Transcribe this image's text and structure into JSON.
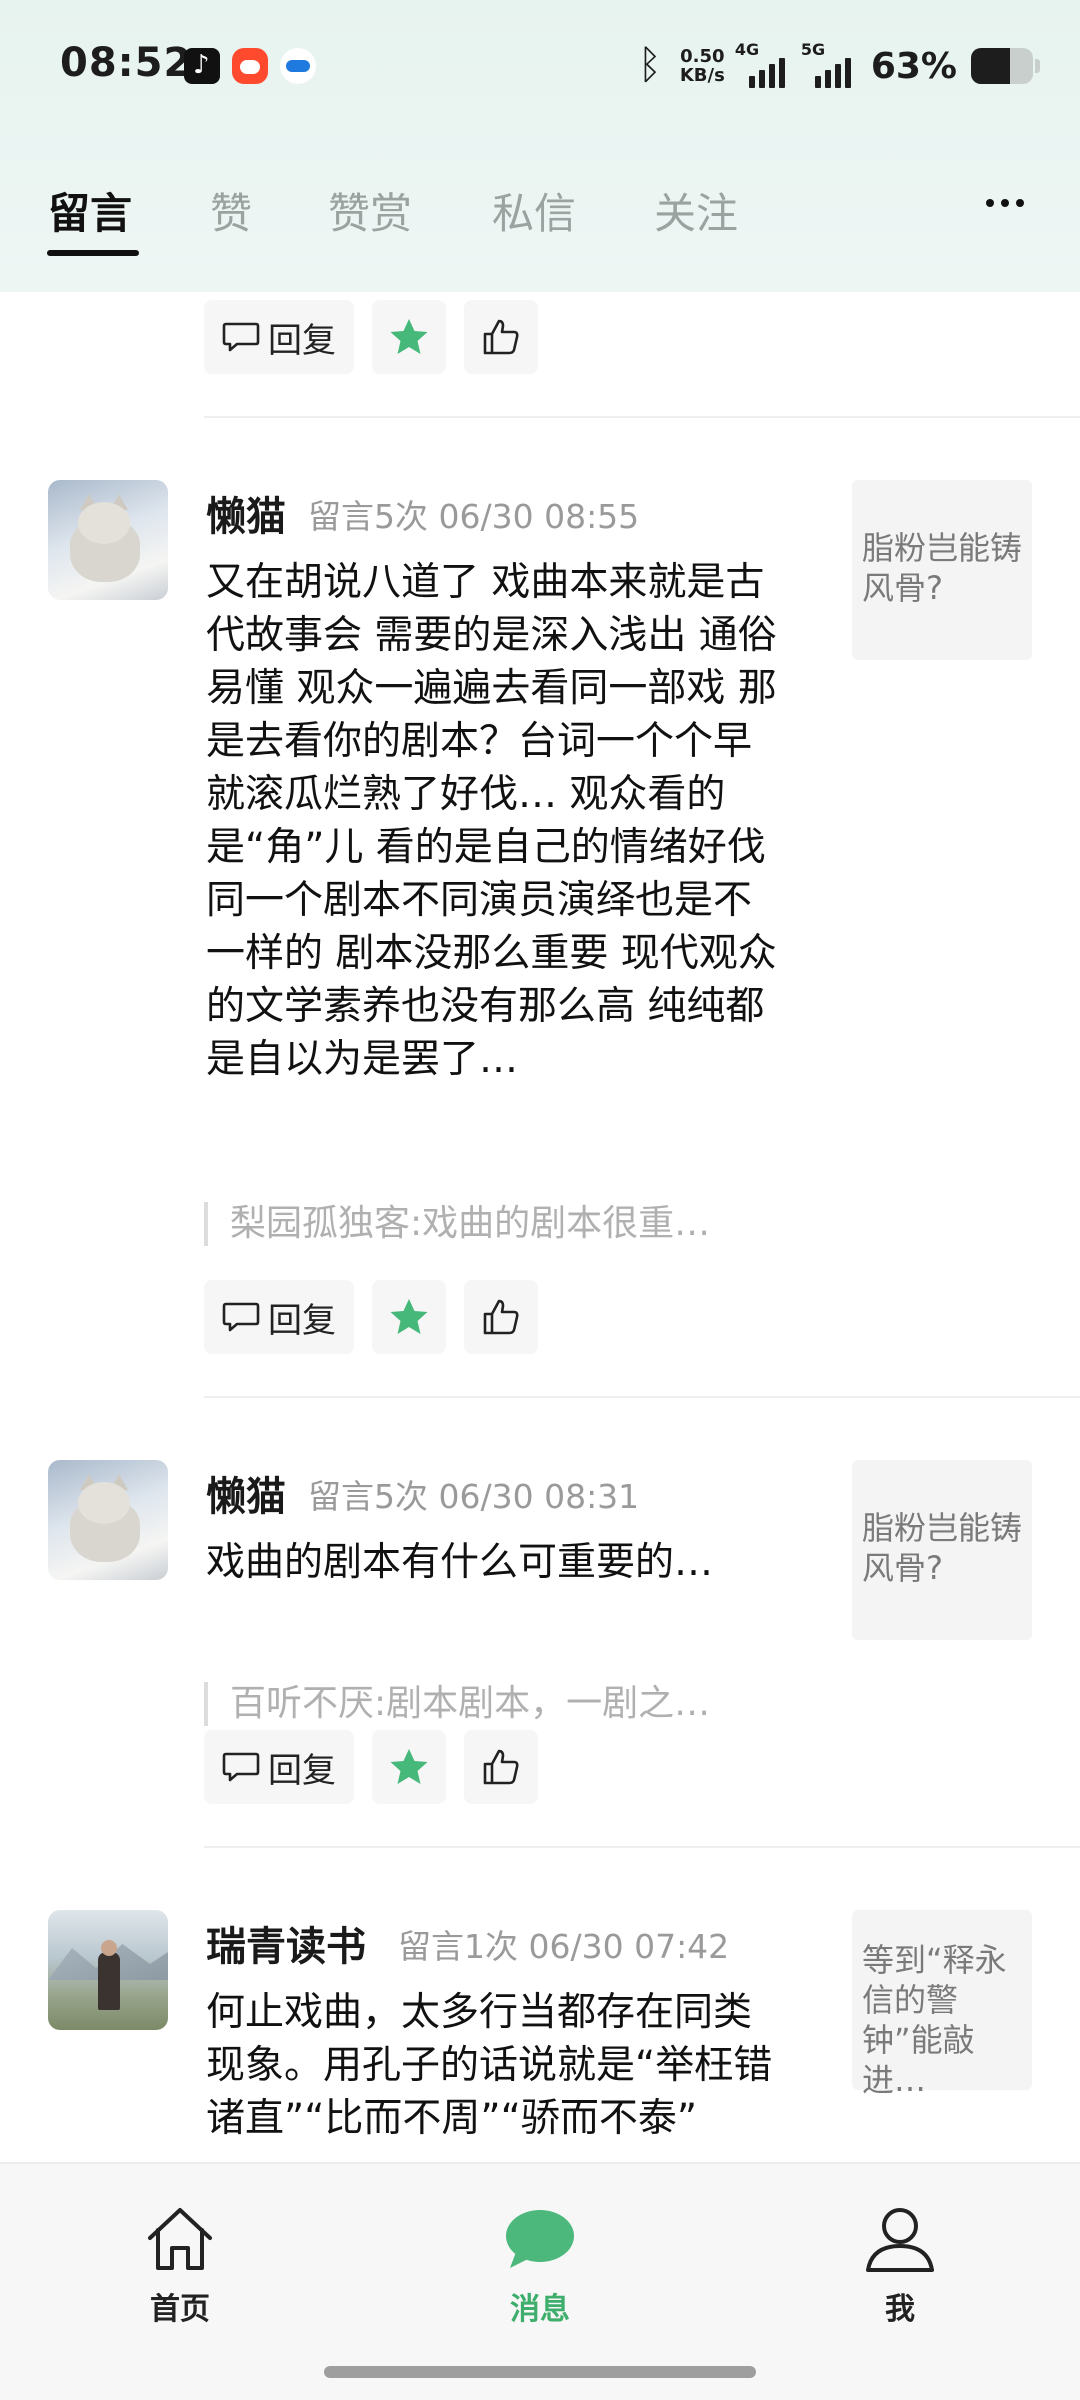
{
  "status_bar": {
    "time": "08:52",
    "net_speed_value": "0.50",
    "net_speed_unit": "KB/s",
    "net1": "4G",
    "net2": "5G",
    "battery_pct": "63%",
    "battery_level": 0.63,
    "notification_icons": [
      "tiktok-icon",
      "red-app-icon",
      "blue-app-icon"
    ]
  },
  "tabs": [
    {
      "label": "留言",
      "active": true
    },
    {
      "label": "赞",
      "active": false
    },
    {
      "label": "赞赏",
      "active": false
    },
    {
      "label": "私信",
      "active": false
    },
    {
      "label": "关注",
      "active": false
    }
  ],
  "actions": {
    "reply_label": "回复"
  },
  "comments": [
    {
      "name": "懒猫",
      "meta": "留言5次 06/30 08:55",
      "text": "又在胡说八道了 戏曲本来就是古代故事会 需要的是深入浅出 通俗易懂 观众一遍遍去看同一部戏 那是去看你的剧本？台词一个个早就滚瓜烂熟了好伐…  观众看的是“角”儿 看的是自己的情绪好伐 同一个剧本不同演员演绎也是不一样的 剧本没那么重要 现代观众的文学素养也没有那么高 纯纯都是自以为是罢了…",
      "quote": "梨园孤独客:戏曲的剧本很重…",
      "article": "脂粉岂能铸风骨?"
    },
    {
      "name": "懒猫",
      "meta": "留言5次 06/30 08:31",
      "text": "戏曲的剧本有什么可重要的…",
      "quote": "百听不厌:剧本剧本，一剧之…",
      "article": "脂粉岂能铸风骨?"
    },
    {
      "name": "瑞青读书",
      "meta": "留言1次 06/30 07:42",
      "text": "何止戏曲，太多行当都存在同类现象。用孔子的话说就是“举枉错诸直”“比而不周”“骄而不泰”",
      "article": "等到“释永信的警钟”能敲进…"
    }
  ],
  "bottom_nav": [
    {
      "label": "首页",
      "icon": "home-icon",
      "active": false
    },
    {
      "label": "消息",
      "icon": "message-icon",
      "active": true
    },
    {
      "label": "我",
      "icon": "profile-icon",
      "active": false
    }
  ],
  "colors": {
    "accent_green": "#3fae6d",
    "header_bg": "#e7f3ef",
    "inactive_tab": "#9aa3a0"
  }
}
